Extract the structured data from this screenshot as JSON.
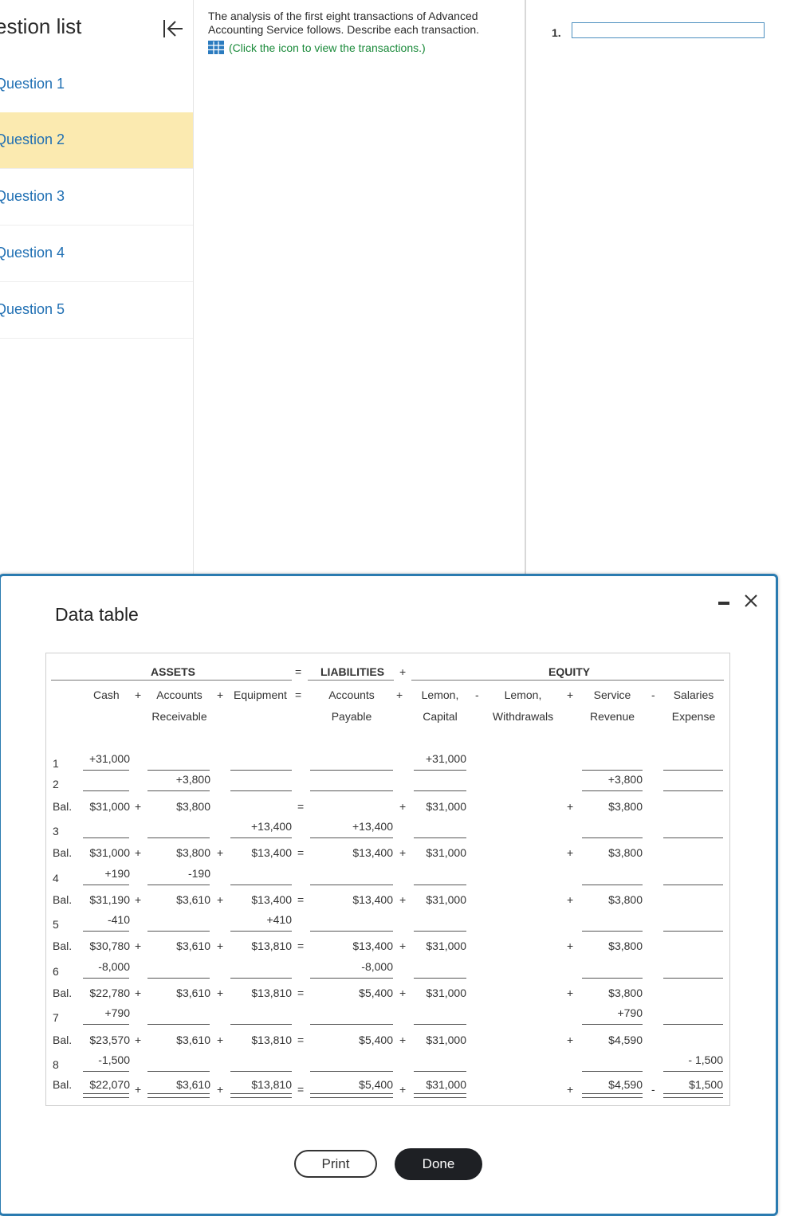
{
  "sidebar": {
    "title": "estion list",
    "items": [
      {
        "label": "Question 1"
      },
      {
        "label": "Question 2"
      },
      {
        "label": "Question 3"
      },
      {
        "label": "Question 4"
      },
      {
        "label": "Question 5"
      }
    ]
  },
  "question": {
    "text": "The analysis of the first eight transactions of Advanced Accounting Service follows. Describe each transaction.",
    "link_text": "(Click the icon to view the transactions.)"
  },
  "answer": {
    "number": "1.",
    "value": ""
  },
  "modal": {
    "title": "Data table",
    "print_label": "Print",
    "done_label": "Done"
  },
  "table": {
    "group_headers": {
      "assets": "ASSETS",
      "eq": "=",
      "liabilities": "LIABILITIES",
      "plus": "+",
      "equity": "EQUITY"
    },
    "columns": {
      "cash": "Cash",
      "ar1": "Accounts",
      "ar2": "Receivable",
      "equipment": "Equipment",
      "ap1": "Accounts",
      "ap2": "Payable",
      "cap1": "Lemon,",
      "cap2": "Capital",
      "wd1": "Lemon,",
      "wd2": "Withdrawals",
      "rev1": "Service",
      "rev2": "Revenue",
      "sal1": "Salaries",
      "sal2": "Expense"
    },
    "op_symbols": {
      "plus": "+",
      "minus": "-",
      "equals": "="
    },
    "rows": [
      {
        "label": "1",
        "cash": "+31,000",
        "ar": "",
        "equip": "",
        "ap": "",
        "cap": "+31,000",
        "rev": "",
        "sal": ""
      },
      {
        "label": "2",
        "cash": "",
        "ar": "+3,800",
        "equip": "",
        "ap": "",
        "cap": "",
        "rev": "+3,800",
        "sal": ""
      },
      {
        "label": "Bal.",
        "cash": "$31,000",
        "ar": "$3,800",
        "equip": "",
        "ap": "",
        "cap": "$31,000",
        "rev": "$3,800",
        "sal": ""
      },
      {
        "label": "3",
        "cash": "",
        "ar": "",
        "equip": "+13,400",
        "ap": "+13,400",
        "cap": "",
        "rev": "",
        "sal": ""
      },
      {
        "label": "Bal.",
        "cash": "$31,000",
        "ar": "$3,800",
        "equip": "$13,400",
        "ap": "$13,400",
        "cap": "$31,000",
        "rev": "$3,800",
        "sal": ""
      },
      {
        "label": "4",
        "cash": "+190",
        "ar": "-190",
        "equip": "",
        "ap": "",
        "cap": "",
        "rev": "",
        "sal": ""
      },
      {
        "label": "Bal.",
        "cash": "$31,190",
        "ar": "$3,610",
        "equip": "$13,400",
        "ap": "$13,400",
        "cap": "$31,000",
        "rev": "$3,800",
        "sal": ""
      },
      {
        "label": "5",
        "cash": "-410",
        "ar": "",
        "equip": "+410",
        "ap": "",
        "cap": "",
        "rev": "",
        "sal": ""
      },
      {
        "label": "Bal.",
        "cash": "$30,780",
        "ar": "$3,610",
        "equip": "$13,810",
        "ap": "$13,400",
        "cap": "$31,000",
        "rev": "$3,800",
        "sal": ""
      },
      {
        "label": "6",
        "cash": "-8,000",
        "ar": "",
        "equip": "",
        "ap": "-8,000",
        "cap": "",
        "rev": "",
        "sal": ""
      },
      {
        "label": "Bal.",
        "cash": "$22,780",
        "ar": "$3,610",
        "equip": "$13,810",
        "ap": "$5,400",
        "cap": "$31,000",
        "rev": "$3,800",
        "sal": ""
      },
      {
        "label": "7",
        "cash": "+790",
        "ar": "",
        "equip": "",
        "ap": "",
        "cap": "",
        "rev": "+790",
        "sal": ""
      },
      {
        "label": "Bal.",
        "cash": "$23,570",
        "ar": "$3,610",
        "equip": "$13,810",
        "ap": "$5,400",
        "cap": "$31,000",
        "rev": "$4,590",
        "sal": ""
      },
      {
        "label": "8",
        "cash": "-1,500",
        "ar": "",
        "equip": "",
        "ap": "",
        "cap": "",
        "rev": "",
        "sal": "- 1,500"
      },
      {
        "label": "Bal.",
        "cash": "$22,070",
        "ar": "$3,610",
        "equip": "$13,810",
        "ap": "$5,400",
        "cap": "$31,000",
        "rev": "$4,590",
        "sal": "$1,500"
      }
    ]
  }
}
